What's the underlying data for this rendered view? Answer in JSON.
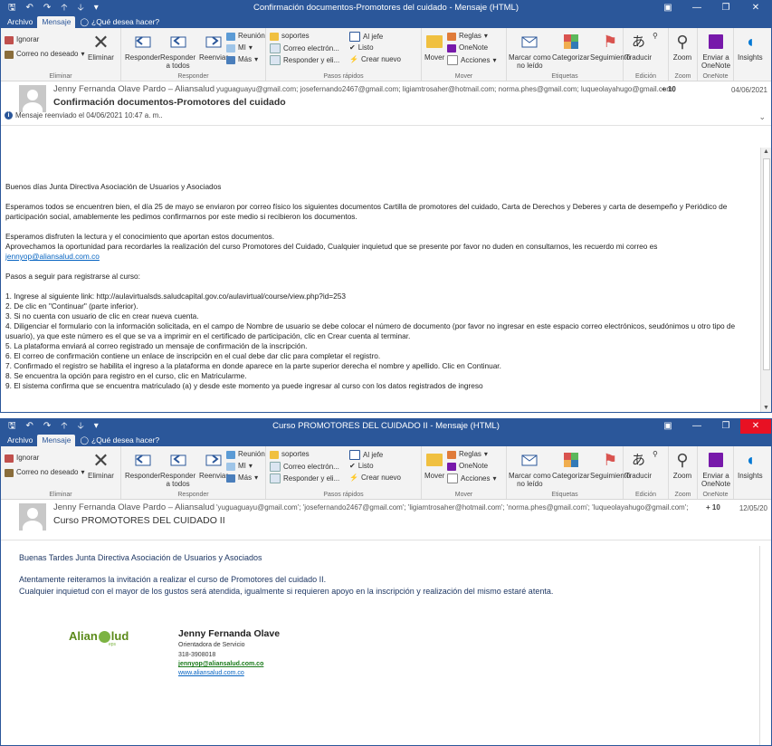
{
  "app": {
    "qa_icons": [
      "save-icon",
      "undo-icon",
      "redo-icon",
      "up-icon",
      "down-icon",
      "customize-icon"
    ],
    "controls": [
      "ribbon-display-icon",
      "minimize-icon",
      "restore-icon",
      "close-icon"
    ],
    "accent": "#2b579a"
  },
  "tabs": {
    "archivo": "Archivo",
    "mensaje": "Mensaje",
    "tell": "¿Qué desea hacer?"
  },
  "ribbon": {
    "ignorar": "Ignorar",
    "correo_no_deseado": "Correo no deseado",
    "eliminar": "Eliminar",
    "group_eliminar": "Eliminar",
    "responder": "Responder",
    "responder_todos_1": "Responder",
    "responder_todos_2": "a todos",
    "reenviar": "Reenviar",
    "reunion": "Reunión",
    "mi": "MI",
    "mas": "Más",
    "group_responder": "Responder",
    "qs_soportes": "soportes",
    "qs_correo": "Correo electrón...",
    "qs_responder": "Responder y eli...",
    "qs_jefe": "Al jefe",
    "qs_listo": "Listo",
    "qs_crear": "Crear nuevo",
    "group_pasos": "Pasos rápidos",
    "mover": "Mover",
    "reglas": "Reglas",
    "onenote": "OneNote",
    "acciones": "Acciones",
    "group_mover": "Mover",
    "marcar_1": "Marcar como",
    "marcar_2": "no leído",
    "categorizar": "Categorizar",
    "seguimiento": "Seguimiento",
    "group_etiquetas": "Etiquetas",
    "traducir": "Traducir",
    "group_edicion": "Edición",
    "zoom": "Zoom",
    "group_zoom": "Zoom",
    "enviar_1": "Enviar a",
    "enviar_2": "OneNote",
    "group_onenote": "OneNote",
    "insights": "Insights"
  },
  "win1": {
    "title": "Confirmación documentos-Promotores del cuidado  -  Mensaje (HTML)",
    "from": "Jenny Fernanda Olave Pardo – Aliansalud",
    "to": "yuguaguayu@gmail.com;  josefernando2467@gmail.com;  ligiamtrosaher@hotmail.com;  norma.phes@gmail.com;  luqueolayahugo@gmail.com;",
    "more": "+ 10",
    "date": "04/06/2021",
    "subject": "Confirmación documentos-Promotores del cuidado",
    "forwarded": "Mensaje reenviado el 04/06/2021 10:47 a. m..",
    "greeting": "Buenos días  Junta Directiva Asociación de Usuarios y Asociados",
    "p1": "Esperamos todos se encuentren bien, el día 25 de mayo se enviaron por correo físico los siguientes documentos Cartilla de promotores del cuidado, Carta de Derechos y Deberes y carta de desempeño  y Periódico de participación social, amablemente les pedimos confirmarnos por este medio si recibieron los documentos.",
    "p2a": "Esperamos disfruten la lectura y el conocimiento que aportan estos documentos.",
    "p2b": "Aprovechamos la oportunidad para recordarles la realización del curso Promotores del Cuidado, Cualquier inquietud que se presente por favor no duden en consultarnos, les recuerdo mi correo es",
    "email": "jennyop@aliansalud.com.co",
    "pasos": "Pasos a seguir para registrarse al curso:",
    "steps": [
      "1. Ingrese al siguiente link:  http://aulavirtualsds.saludcapital.gov.co/aulavirtual/course/view.php?id=253",
      "2. De clic en \"Continuar\" (parte inferior).",
      "3. Si no cuenta con usuario de clic en crear nueva cuenta.",
      "4. Diligenciar el formulario con la información solicitada, en el campo de Nombre de usuario se debe colocar el número de documento (por favor no ingresar en este espacio correo electrónicos, seudónimos u otro tipo de usuario), ya que este número es el que se va a imprimir en el certificado de participación, clic en Crear cuenta al terminar.",
      "5. La plataforma enviará al correo registrado un mensaje de confirmación de la inscripción.",
      "6. El correo de confirmación contiene un enlace de inscripción en el cual debe dar clic para completar el registro.",
      "7. Confirmado el registro se habilita el ingreso a la plataforma en donde aparece en la parte superior derecha el nombre y apellido. Clic en Continuar.",
      "8. Se encuentra la opción para registro en el curso, clic en Matricularme.",
      "9. El sistema confirma que se encuentra matriculado (a) y desde este momento ya puede ingresar al curso con los datos registrados de ingreso"
    ]
  },
  "win2": {
    "title": "Curso PROMOTORES DEL CUIDADO  II  -  Mensaje (HTML)",
    "from": "Jenny Fernanda Olave Pardo – Aliansalud",
    "to": "'yuguaguayu@gmail.com';  'josefernando2467@gmail.com';  'ligiamtrosaher@hotmail.com';  'norma.phes@gmail.com';  'luqueolayahugo@gmail.com';",
    "more": "+ 10",
    "date": "12/05/20",
    "subject": "Curso PROMOTORES DEL CUIDADO  II",
    "greeting": "Buenas Tardes Junta Directiva Asociación de Usuarios y Asociados",
    "p1": "Atentamente reiteramos la invitación a realizar el curso de Promotores del cuidado II.",
    "p2": "Cualquier inquietud con el mayor de los gustos será atendida, igualmente si requieren apoyo en la inscripción y realización del mismo estaré atenta.",
    "sig_name": "Jenny Fernanda Olave",
    "sig_role": "Orientadora de Servicio",
    "sig_phone": "318-3908018",
    "sig_email": "jennyop@aliansalud.com.co",
    "sig_web": "www.aliansalud.com.co",
    "logo_a": "Alian",
    "logo_b": "lud",
    "logo_eps": "eps"
  }
}
